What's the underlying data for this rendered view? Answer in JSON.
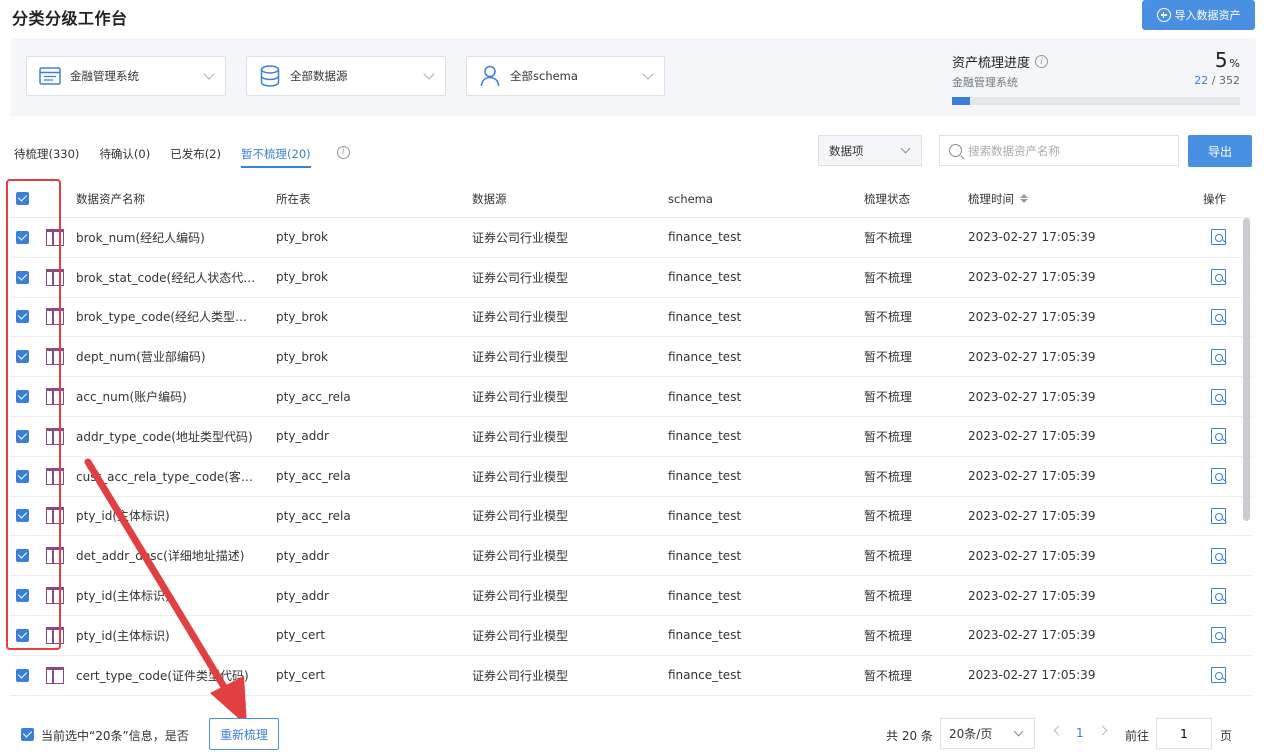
{
  "page_title": "分类分级工作台",
  "import_button": "导入数据资产",
  "filters": {
    "system": "金融管理系统",
    "datasource": "全部数据源",
    "schema": "全部schema"
  },
  "progress": {
    "title": "资产梳理进度",
    "subtitle": "金融管理系统",
    "percent": "5",
    "percent_unit": "%",
    "current": "22",
    "total": "/ 352",
    "fraction": 0.0625
  },
  "tabs": [
    {
      "label": "待梳理(330)"
    },
    {
      "label": "待确认(0)"
    },
    {
      "label": "已发布(2)"
    },
    {
      "label": "暂不梳理(20)"
    }
  ],
  "toolbar": {
    "type_select": "数据项",
    "search_placeholder": "搜索数据资产名称",
    "export": "导出"
  },
  "table": {
    "headers": {
      "name": "数据资产名称",
      "table": "所在表",
      "datasource": "数据源",
      "schema": "schema",
      "status": "梳理状态",
      "time": "梳理时间",
      "op": "操作"
    },
    "rows": [
      {
        "name": "brok_num(经纪人编码)",
        "table": "pty_brok",
        "datasource": "证券公司行业模型",
        "schema": "finance_test",
        "status": "暂不梳理",
        "time": "2023-02-27 17:05:39"
      },
      {
        "name": "brok_stat_code(经纪人状态代…",
        "table": "pty_brok",
        "datasource": "证券公司行业模型",
        "schema": "finance_test",
        "status": "暂不梳理",
        "time": "2023-02-27 17:05:39"
      },
      {
        "name": "brok_type_code(经纪人类型…",
        "table": "pty_brok",
        "datasource": "证券公司行业模型",
        "schema": "finance_test",
        "status": "暂不梳理",
        "time": "2023-02-27 17:05:39"
      },
      {
        "name": "dept_num(营业部编码)",
        "table": "pty_brok",
        "datasource": "证券公司行业模型",
        "schema": "finance_test",
        "status": "暂不梳理",
        "time": "2023-02-27 17:05:39"
      },
      {
        "name": "acc_num(账户编码)",
        "table": "pty_acc_rela",
        "datasource": "证券公司行业模型",
        "schema": "finance_test",
        "status": "暂不梳理",
        "time": "2023-02-27 17:05:39"
      },
      {
        "name": "addr_type_code(地址类型代码)",
        "table": "pty_addr",
        "datasource": "证券公司行业模型",
        "schema": "finance_test",
        "status": "暂不梳理",
        "time": "2023-02-27 17:05:39"
      },
      {
        "name": "cust_acc_rela_type_code(客…",
        "table": "pty_acc_rela",
        "datasource": "证券公司行业模型",
        "schema": "finance_test",
        "status": "暂不梳理",
        "time": "2023-02-27 17:05:39"
      },
      {
        "name": "pty_id(主体标识)",
        "table": "pty_acc_rela",
        "datasource": "证券公司行业模型",
        "schema": "finance_test",
        "status": "暂不梳理",
        "time": "2023-02-27 17:05:39"
      },
      {
        "name": "det_addr_desc(详细地址描述)",
        "table": "pty_addr",
        "datasource": "证券公司行业模型",
        "schema": "finance_test",
        "status": "暂不梳理",
        "time": "2023-02-27 17:05:39"
      },
      {
        "name": "pty_id(主体标识)",
        "table": "pty_addr",
        "datasource": "证券公司行业模型",
        "schema": "finance_test",
        "status": "暂不梳理",
        "time": "2023-02-27 17:05:39"
      },
      {
        "name": "pty_id(主体标识)",
        "table": "pty_cert",
        "datasource": "证券公司行业模型",
        "schema": "finance_test",
        "status": "暂不梳理",
        "time": "2023-02-27 17:05:39"
      },
      {
        "name": "cert_type_code(证件类型代码)",
        "table": "pty_cert",
        "datasource": "证券公司行业模型",
        "schema": "finance_test",
        "status": "暂不梳理",
        "time": "2023-02-27 17:05:39"
      }
    ]
  },
  "footer": {
    "selection_text": "当前选中“20条”信息，是否",
    "recomb_button": "重新梳理",
    "total": "共 20 条",
    "page_size": "20条/页",
    "current_page": "1",
    "goto_label": "前往",
    "goto_value": "1",
    "goto_suffix": "页"
  },
  "colors": {
    "accent": "#3a80d9",
    "annotation": "#e04040"
  }
}
